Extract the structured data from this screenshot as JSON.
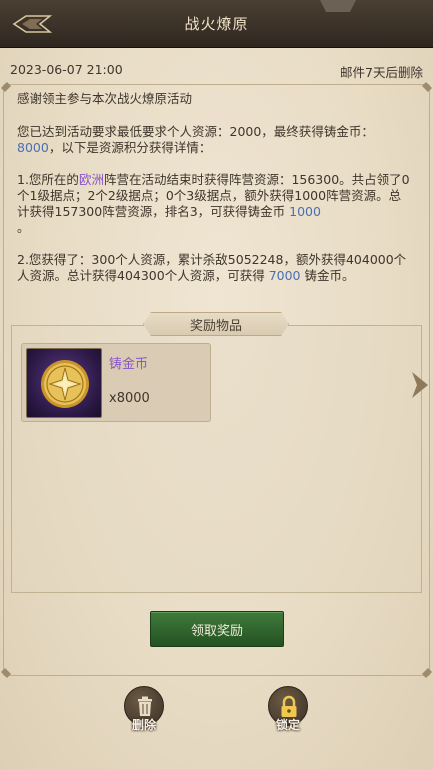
{
  "header": {
    "title": "战火燎原"
  },
  "mail": {
    "date": "2023-06-07 21:00",
    "expire": "邮件7天后删除",
    "greeting": "感谢领主参与本次战火燎原活动",
    "p1_a": "您已达到活动要求最低要求个人资源：2000，最终获得铸金币：",
    "p1_value": "8000",
    "p1_b": "，以下是资源积分获得详情：",
    "p2_a": "1.您所在的",
    "p2_faction": "欧洲",
    "p2_b": "阵营在活动结束时获得阵营资源：156300。共占领了0个1级据点；2个2级据点；0个3级据点，额外获得1000阵营资源。总计获得157300阵营资源，排名3，可获得铸金币 ",
    "p2_value": "1000",
    "p2_c": "。",
    "p3_a": "2.您获得了：300个人资源，累计杀敌5052248，额外获得404000个人资源。总计获得404300个人资源，可获得 ",
    "p3_value": "7000",
    "p3_b": " 铸金币。"
  },
  "rewards": {
    "title": "奖励物品",
    "items": [
      {
        "name": "铸金币",
        "quantity": "x8000",
        "icon": "gold-coin-icon"
      }
    ]
  },
  "buttons": {
    "claim": "领取奖励",
    "delete": "删除",
    "lock": "锁定"
  },
  "colors": {
    "accent_purple": "#8a55c7",
    "accent_blue": "#4a6fb5",
    "claim_green": "#2f6a2c"
  }
}
